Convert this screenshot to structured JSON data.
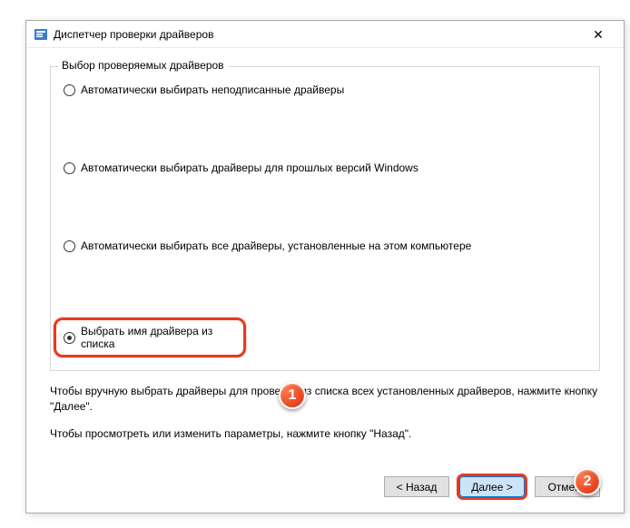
{
  "window": {
    "title": "Диспетчер проверки драйверов"
  },
  "group": {
    "legend": "Выбор проверяемых драйверов",
    "options": [
      {
        "label": "Автоматически выбирать неподписанные драйверы"
      },
      {
        "label": "Автоматически выбирать драйверы для прошлых версий Windows"
      },
      {
        "label": "Автоматически выбирать все драйверы, установленные на этом компьютере"
      },
      {
        "label": "Выбрать имя драйвера из списка"
      }
    ]
  },
  "help": {
    "line1": "Чтобы вручную выбрать драйверы для проверки из списка всех установленных драйверов, нажмите кнопку \"Далее\".",
    "line2": "Чтобы просмотреть или изменить параметры, нажмите кнопку \"Назад\"."
  },
  "buttons": {
    "back": "< Назад",
    "next": "Далее >",
    "cancel": "Отмена"
  },
  "badges": {
    "one": "1",
    "two": "2"
  }
}
